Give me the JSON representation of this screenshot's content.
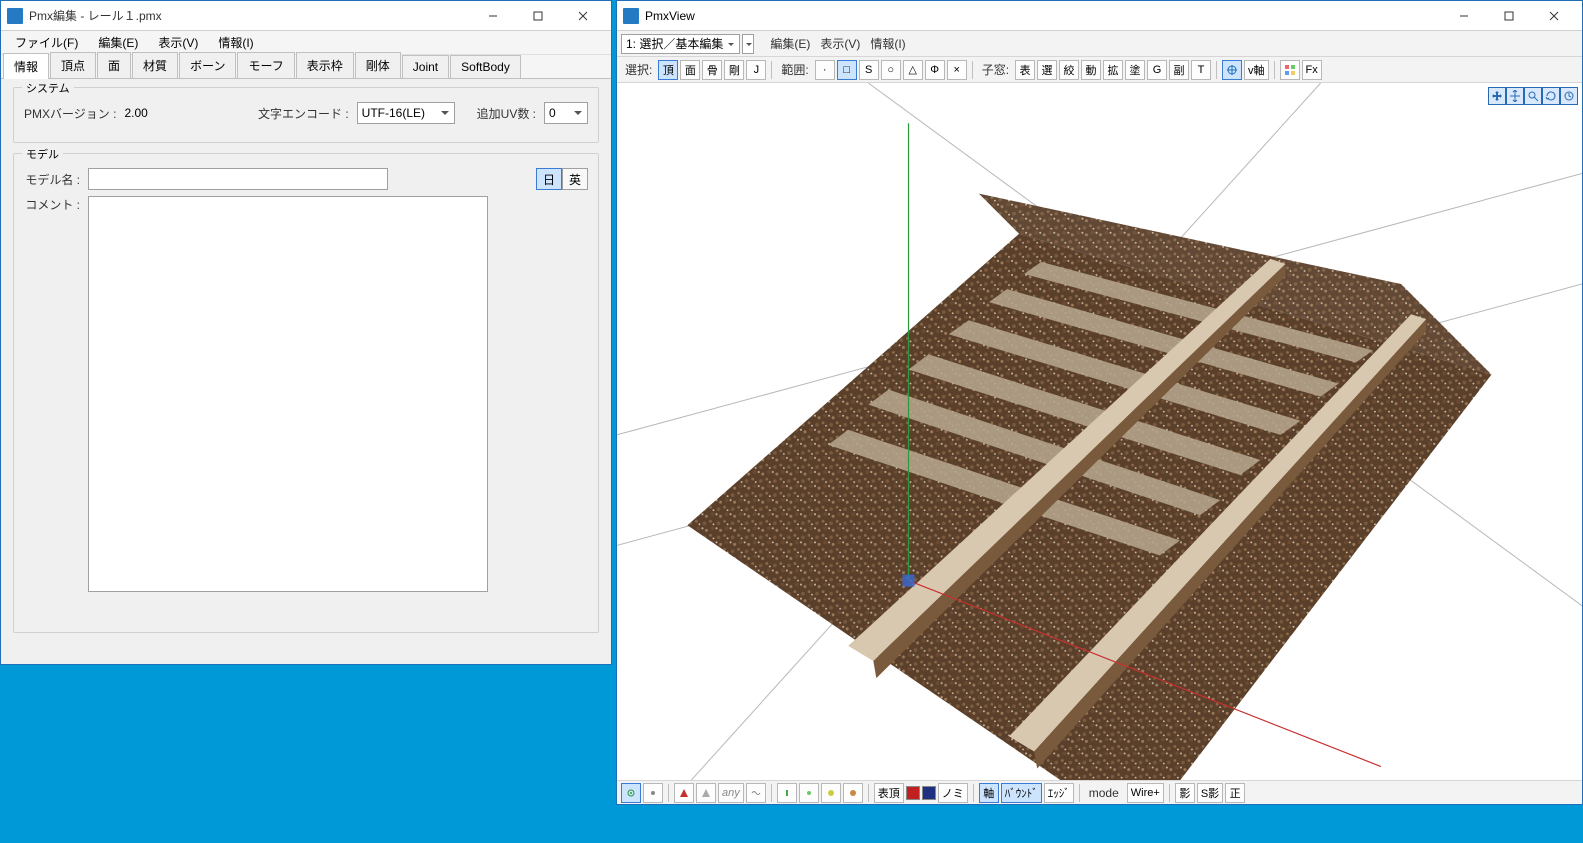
{
  "editor": {
    "title": "Pmx編集 - レール１.pmx",
    "menu": [
      "ファイル(F)",
      "編集(E)",
      "表示(V)",
      "情報(I)"
    ],
    "tabs": [
      "情報",
      "頂点",
      "面",
      "材質",
      "ボーン",
      "モーフ",
      "表示枠",
      "剛体",
      "Joint",
      "SoftBody"
    ],
    "active_tab": "情報",
    "system_legend": "システム",
    "pmx_version_label": "PMXバージョン :",
    "pmx_version": "2.00",
    "encode_label": "文字エンコード :",
    "encode_value": "UTF-16(LE)",
    "uv_label": "追加UV数 :",
    "uv_value": "0",
    "model_legend": "モデル",
    "model_name_label": "モデル名 :",
    "model_name": "",
    "lang_jp": "日",
    "lang_en": "英",
    "comment_label": "コメント :",
    "comment": ""
  },
  "viewer": {
    "title": "PmxView",
    "mode_dd": "1: 選択／基本編集",
    "menu": [
      "編集(E)",
      "表示(V)",
      "情報(I)"
    ],
    "row2": {
      "select_label": "選択:",
      "btns1": [
        "頂",
        "面",
        "骨",
        "剛",
        "J"
      ],
      "range_label": "範囲:",
      "shape_rect": "□",
      "shape_s": "S",
      "shape_circle": "○",
      "shape_tri": "△",
      "shape_phi": "Φ",
      "shape_x": "×",
      "child_label": "子窓:",
      "btns2": [
        "表",
        "選",
        "絞",
        "動",
        "拡",
        "塗",
        "G",
        "副",
        "T"
      ],
      "axis_btn": "v軸",
      "grid_btn": "",
      "fx_btn": "Fx"
    },
    "status": {
      "mode_label": "mode",
      "wire_label": "Wire+",
      "btns": [
        "表頂",
        "ノミ",
        "軸",
        "ﾊﾞｳﾝﾄﾞ",
        "ｴｯｼﾞ",
        "影",
        "S影",
        "正"
      ]
    }
  }
}
